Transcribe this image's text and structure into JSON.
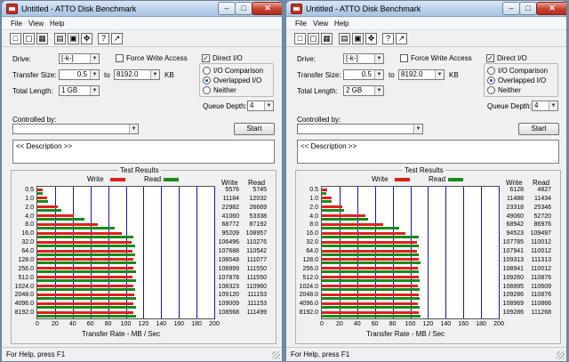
{
  "windows": [
    {
      "title": "Untitled - ATTO Disk Benchmark",
      "menu": [
        "File",
        "View",
        "Help"
      ],
      "drive_label": "Drive:",
      "drive_value": "[-k-]",
      "force_write_label": "Force Write Access",
      "direct_io_label": "Direct I/O",
      "transfer_size_label": "Transfer Size:",
      "transfer_from": "0.5",
      "to_label": "to",
      "transfer_to": "8192.0",
      "kb_label": "KB",
      "total_length_label": "Total Length:",
      "total_length": "1 GB",
      "io_comparison_label": "I/O Comparison",
      "overlapped_io_label": "Overlapped I/O",
      "neither_label": "Neither",
      "queue_depth_label": "Queue Depth:",
      "queue_depth": "4",
      "controlled_by_label": "Controlled by:",
      "start_label": "Start",
      "description": "<< Description >>",
      "test_results_label": "Test Results",
      "write_label": "Write",
      "read_label": "Read",
      "col_write": "Write",
      "col_read": "Read",
      "xaxis_label": "Transfer Rate - MB / Sec",
      "status": "For Help, press F1",
      "rows": [
        {
          "size": "0.5",
          "write": "5576",
          "read": "5745"
        },
        {
          "size": "1.0",
          "write": "11184",
          "read": "12032"
        },
        {
          "size": "2.0",
          "write": "22982",
          "read": "26669"
        },
        {
          "size": "4.0",
          "write": "41060",
          "read": "53338"
        },
        {
          "size": "8.0",
          "write": "68772",
          "read": "87192"
        },
        {
          "size": "16.0",
          "write": "95209",
          "read": "108957"
        },
        {
          "size": "32.0",
          "write": "106496",
          "read": "110276"
        },
        {
          "size": "64.0",
          "write": "107688",
          "read": "110542"
        },
        {
          "size": "128.0",
          "write": "108548",
          "read": "111077"
        },
        {
          "size": "256.0",
          "write": "108999",
          "read": "111550"
        },
        {
          "size": "512.0",
          "write": "107878",
          "read": "111550"
        },
        {
          "size": "1024.0",
          "write": "108323",
          "read": "110960"
        },
        {
          "size": "2048.0",
          "write": "109120",
          "read": "111153"
        },
        {
          "size": "4096.0",
          "write": "109009",
          "read": "111153"
        },
        {
          "size": "8192.0",
          "write": "108568",
          "read": "111499"
        }
      ]
    },
    {
      "title": "Untitled - ATTO Disk Benchmark",
      "menu": [
        "File",
        "View",
        "Help"
      ],
      "drive_label": "Drive:",
      "drive_value": "[-k-]",
      "force_write_label": "Force Write Access",
      "direct_io_label": "Direct I/O",
      "transfer_size_label": "Transfer Size:",
      "transfer_from": "0.5",
      "to_label": "to",
      "transfer_to": "8192.0",
      "kb_label": "KB",
      "total_length_label": "Total Length:",
      "total_length": "2 GB",
      "io_comparison_label": "I/O Comparison",
      "overlapped_io_label": "Overlapped I/O",
      "neither_label": "Neither",
      "queue_depth_label": "Queue Depth:",
      "queue_depth": "4",
      "controlled_by_label": "Controlled by:",
      "start_label": "Start",
      "description": "<< Description >>",
      "test_results_label": "Test Results",
      "write_label": "Write",
      "read_label": "Read",
      "col_write": "Write",
      "col_read": "Read",
      "xaxis_label": "Transfer Rate - MB / Sec",
      "status": "For Help, press F1",
      "rows": [
        {
          "size": "0.5",
          "write": "6128",
          "read": "4827"
        },
        {
          "size": "1.0",
          "write": "11488",
          "read": "11434"
        },
        {
          "size": "2.0",
          "write": "23318",
          "read": "25346"
        },
        {
          "size": "4.0",
          "write": "49060",
          "read": "52720"
        },
        {
          "size": "8.0",
          "write": "68942",
          "read": "86976"
        },
        {
          "size": "16.0",
          "write": "94523",
          "read": "109497"
        },
        {
          "size": "32.0",
          "write": "107785",
          "read": "110012"
        },
        {
          "size": "64.0",
          "write": "107941",
          "read": "110012"
        },
        {
          "size": "128.0",
          "write": "109313",
          "read": "111313"
        },
        {
          "size": "256.0",
          "write": "108941",
          "read": "110012"
        },
        {
          "size": "512.0",
          "write": "109260",
          "read": "110876"
        },
        {
          "size": "1024.0",
          "write": "108895",
          "read": "110609"
        },
        {
          "size": "2048.0",
          "write": "109286",
          "read": "110876"
        },
        {
          "size": "4096.0",
          "write": "108969",
          "read": "110866"
        },
        {
          "size": "8192.0",
          "write": "109286",
          "read": "111268"
        }
      ]
    }
  ],
  "chart_data": [
    {
      "type": "bar",
      "title": "Test Results",
      "xlabel": "Transfer Rate - MB / Sec",
      "xlim": [
        0,
        200
      ],
      "xticks": [
        "0",
        "20",
        "40",
        "60",
        "80",
        "100",
        "120",
        "140",
        "160",
        "180",
        "200"
      ],
      "categories": [
        "0.5",
        "1.0",
        "2.0",
        "4.0",
        "8.0",
        "16.0",
        "32.0",
        "64.0",
        "128.0",
        "256.0",
        "512.0",
        "1024.0",
        "2048.0",
        "4096.0",
        "8192.0"
      ],
      "series": [
        {
          "name": "Write",
          "color": "#e0201c",
          "values": [
            5.576,
            11.184,
            22.982,
            41.06,
            68.772,
            95.209,
            106.496,
            107.688,
            108.548,
            108.999,
            107.878,
            108.323,
            109.12,
            109.009,
            108.568
          ]
        },
        {
          "name": "Read",
          "color": "#1a8a1a",
          "values": [
            5.745,
            12.032,
            26.669,
            53.338,
            87.192,
            108.957,
            110.276,
            110.542,
            111.077,
            111.55,
            111.55,
            110.96,
            111.153,
            111.153,
            111.499
          ]
        }
      ]
    },
    {
      "type": "bar",
      "title": "Test Results",
      "xlabel": "Transfer Rate - MB / Sec",
      "xlim": [
        0,
        200
      ],
      "xticks": [
        "0",
        "20",
        "40",
        "60",
        "80",
        "100",
        "120",
        "140",
        "160",
        "180",
        "200"
      ],
      "categories": [
        "0.5",
        "1.0",
        "2.0",
        "4.0",
        "8.0",
        "16.0",
        "32.0",
        "64.0",
        "128.0",
        "256.0",
        "512.0",
        "1024.0",
        "2048.0",
        "4096.0",
        "8192.0"
      ],
      "series": [
        {
          "name": "Write",
          "color": "#e0201c",
          "values": [
            6.128,
            11.488,
            23.318,
            49.06,
            68.942,
            94.523,
            107.785,
            107.941,
            109.313,
            108.941,
            109.26,
            108.895,
            109.286,
            108.969,
            109.286
          ]
        },
        {
          "name": "Read",
          "color": "#1a8a1a",
          "values": [
            4.827,
            11.434,
            25.346,
            52.72,
            86.976,
            109.497,
            110.012,
            110.012,
            111.313,
            110.012,
            110.876,
            110.609,
            110.876,
            110.866,
            111.268
          ]
        }
      ]
    }
  ],
  "colors": {
    "write": "#e0201c",
    "read": "#1a8a1a",
    "grid": "#1616c0"
  }
}
